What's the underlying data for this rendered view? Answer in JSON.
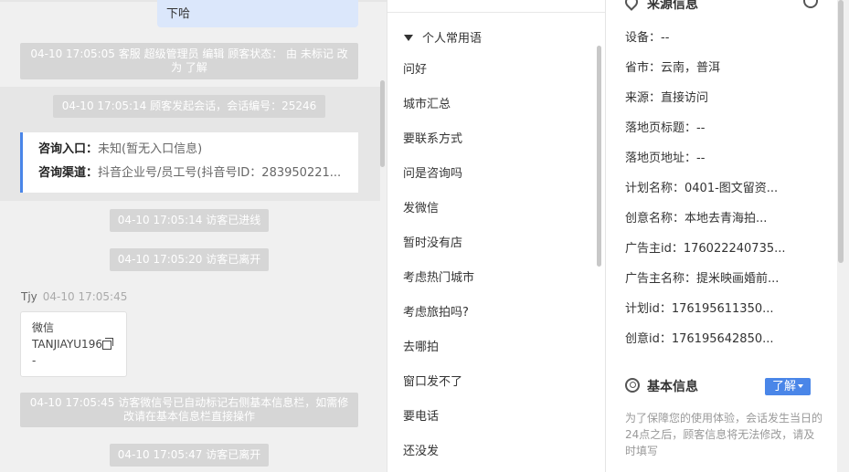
{
  "chat": {
    "partial_bubble_text": "下哈",
    "system_messages": [
      {
        "text": "04-10 17:05:05 客服 超级管理员 编辑 顾客状态： 由 未标记 改为 了解"
      },
      {
        "text": "04-10 17:05:14 顾客发起会话，会话编号：25246"
      },
      {
        "text": "04-10 17:05:14 访客已进线"
      },
      {
        "text": "04-10 17:05:20 访客已离开"
      },
      {
        "text": "04-10 17:05:45 访客微信号已自动标记右侧基本信息栏，如需修改请在基本信息栏直接操作"
      },
      {
        "text": "04-10 17:05:47 访客已离开"
      }
    ],
    "entry_card": {
      "entry_label": "咨询入口：",
      "entry_value": "未知(暂无入口信息)",
      "channel_label": "咨询渠道：",
      "channel_value": "抖音企业号/员工号(抖音号ID：283950221..."
    },
    "sender": {
      "name": "Tjy",
      "time": "04-10 17:05:45"
    },
    "wechat_card": {
      "title": "微信",
      "value": "TANJIAYU196",
      "extra": "-"
    }
  },
  "phrases": {
    "group_title": "个人常用语",
    "items": [
      "问好",
      "城市汇总",
      "要联系方式",
      "问是咨询吗",
      "发微信",
      "暂时没有店",
      "考虑热门城市",
      "考虑旅拍吗?",
      "去哪拍",
      "窗口发不了",
      "要电话",
      "还没发"
    ]
  },
  "info": {
    "source_title": "来源信息",
    "source_items": [
      "设备：--",
      "省市：云南，普洱",
      "来源：直接访问",
      "落地页标题：--",
      "落地页地址：--",
      "计划名称：0401-图文留资...",
      "创意名称：本地去青海拍...",
      "广告主id：176022240735...",
      "广告主名称：提米映画婚前...",
      "计划id：176195611350...",
      "创意id：176195642850..."
    ],
    "basic_title": "基本信息",
    "learn_button": "了解",
    "notice": "为了保障您的使用体验，会话发生当日的24点之后，顾客信息将无法修改，请及时填写"
  }
}
